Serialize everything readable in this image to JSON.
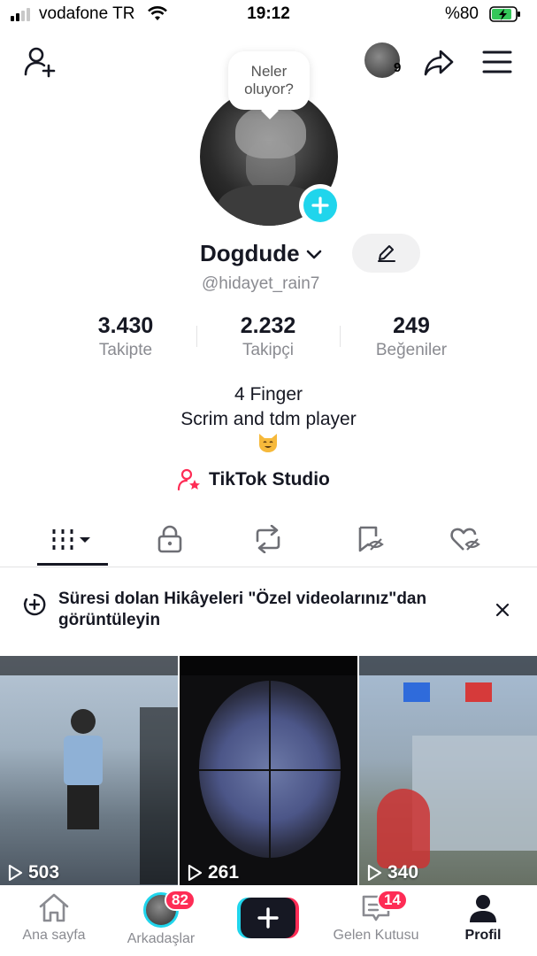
{
  "status_bar": {
    "carrier": "vodafone TR",
    "time": "19:12",
    "battery": "%80"
  },
  "top_bar": {
    "story_count": "9"
  },
  "profile": {
    "bubble_text_line1": "Neler",
    "bubble_text_line2": "oluyor?",
    "display_name": "Dogdude",
    "username": "@hidayet_rain7",
    "stats": [
      {
        "value": "3.430",
        "label": "Takipte"
      },
      {
        "value": "2.232",
        "label": "Takipçi"
      },
      {
        "value": "249",
        "label": "Beğeniler"
      }
    ],
    "bio_line1": "4 Finger",
    "bio_line2": "Scrim and tdm player",
    "studio_label": "TikTok Studio"
  },
  "banner": {
    "text": "Süresi dolan Hikâyeleri \"Özel videolarınız\"dan görüntüleyin"
  },
  "videos": [
    {
      "views": "503"
    },
    {
      "views": "261"
    },
    {
      "views": "340"
    }
  ],
  "nav": {
    "home": "Ana sayfa",
    "friends": "Arkadaşlar",
    "friends_badge": "82",
    "inbox": "Gelen Kutusu",
    "inbox_badge": "14",
    "profile": "Profil"
  },
  "colors": {
    "accent_pink": "#fe2c55",
    "accent_cyan": "#20d5ec",
    "text_primary": "#161823",
    "text_secondary": "#8a8b91"
  }
}
